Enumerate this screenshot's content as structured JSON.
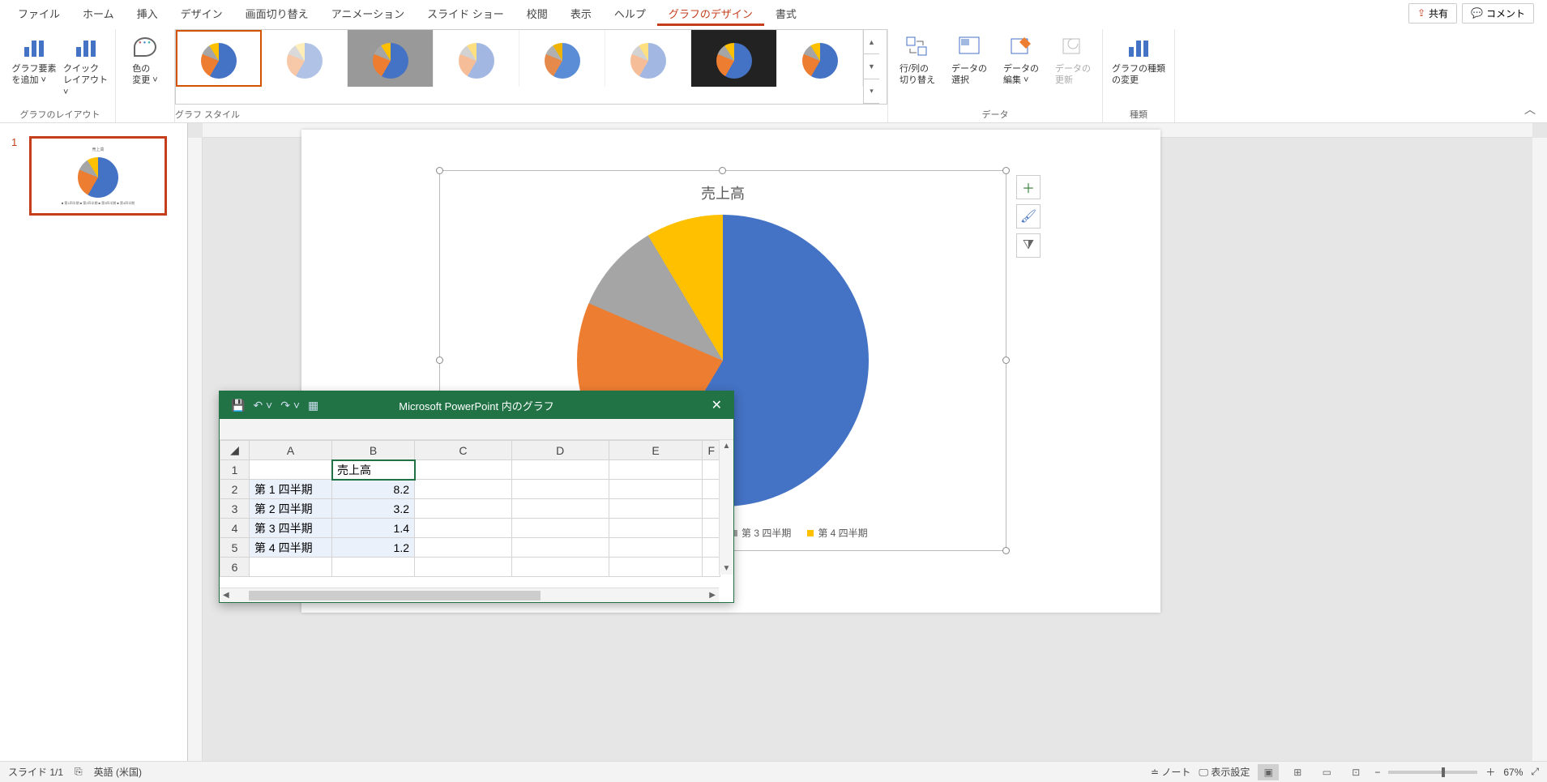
{
  "menubar": {
    "items": [
      "ファイル",
      "ホーム",
      "挿入",
      "デザイン",
      "画面切り替え",
      "アニメーション",
      "スライド ショー",
      "校閲",
      "表示",
      "ヘルプ",
      "グラフのデザイン",
      "書式"
    ],
    "active_index": 10,
    "share": "共有",
    "comment": "コメント"
  },
  "ribbon": {
    "group_layout": {
      "label": "グラフのレイアウト",
      "btn1": "グラフ要素\nを追加 ˅",
      "btn2": "クイック\nレイアウト ˅"
    },
    "group_color": {
      "btn": "色の\n変更 ˅"
    },
    "group_styles": {
      "label": "グラフ スタイル"
    },
    "group_data": {
      "label": "データ",
      "switch": "行/列の\n切り替え",
      "select": "データの\n選択",
      "edit": "データの\n編集 ˅",
      "refresh": "データの\n更新"
    },
    "group_type": {
      "label": "種類",
      "btn": "グラフの種類\nの変更"
    }
  },
  "slides_panel": {
    "number": "1",
    "legend_mini": "■ 第1四半期  ■ 第2四半期  ■ 第3四半期  ■ 第4四半期"
  },
  "chart_data": {
    "type": "pie",
    "title": "売上高",
    "categories": [
      "第 1 四半期",
      "第 2 四半期",
      "第 3 四半期",
      "第 4 四半期"
    ],
    "values": [
      8.2,
      3.2,
      1.4,
      1.2
    ],
    "colors": [
      "#4472C4",
      "#ED7D31",
      "#A5A5A5",
      "#FFC000"
    ]
  },
  "legend": {
    "items": [
      "第 1 四半期",
      "第 2 四半期",
      "第 3 四半期",
      "第 4 四半期"
    ]
  },
  "data_editor": {
    "title": "Microsoft PowerPoint 内のグラフ",
    "cols": [
      "A",
      "B",
      "C",
      "D",
      "E"
    ],
    "row_head_partial": "F",
    "rows": {
      "1": {
        "A": "",
        "B": "売上高"
      },
      "2": {
        "A": "第 1 四半期",
        "B": "8.2"
      },
      "3": {
        "A": "第 2 四半期",
        "B": "3.2"
      },
      "4": {
        "A": "第 3 四半期",
        "B": "1.4"
      },
      "5": {
        "A": "第 4 四半期",
        "B": "1.2"
      },
      "6": {
        "A": "",
        "B": ""
      }
    },
    "active_cell": "B1"
  },
  "statusbar": {
    "slide": "スライド 1/1",
    "lang": "英語 (米国)",
    "notes": "ノート",
    "display": "表示設定",
    "zoom": "67%"
  }
}
